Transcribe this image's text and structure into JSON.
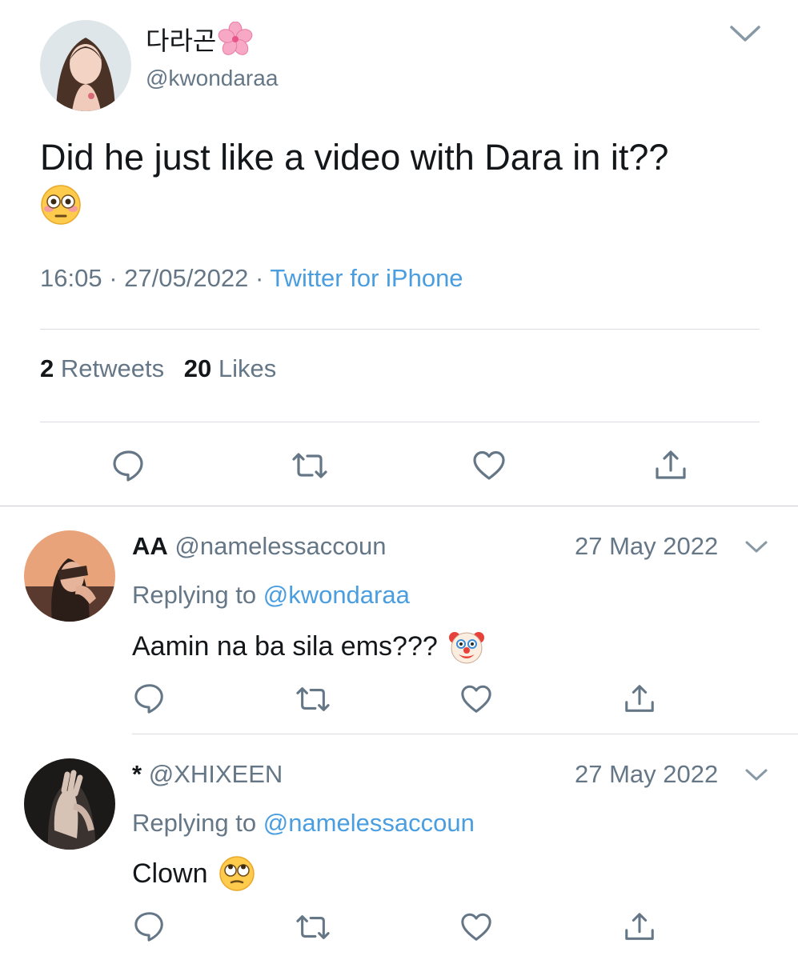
{
  "main_tweet": {
    "display_name": "다라곤",
    "name_emoji": "cherry-blossom-icon",
    "handle": "@kwondaraa",
    "text": "Did he just like a video with Dara in it??",
    "text_emoji": "flushed-face-icon",
    "time": "16:05",
    "date": "27/05/2022",
    "separator": "·",
    "source": "Twitter for iPhone",
    "retweets_count": "2",
    "retweets_label": "Retweets",
    "likes_count": "20",
    "likes_label": "Likes"
  },
  "replies": [
    {
      "name": "AA",
      "handle": "@namelessaccoun",
      "date": "27 May 2022",
      "replying_prefix": "Replying to",
      "replying_to": "@kwondaraa",
      "text": "Aamin na ba sila ems???",
      "emoji": "clown-face-icon"
    },
    {
      "name": "*",
      "handle": "@XHIXEEN",
      "date": "27 May 2022",
      "replying_prefix": "Replying to",
      "replying_to": "@namelessaccoun",
      "text": "Clown",
      "emoji": "eye-roll-face-icon"
    }
  ],
  "colors": {
    "text": "#14171a",
    "secondary": "#657786",
    "link": "#4a9ee0",
    "divider": "#d9dde1",
    "icon": "#657786"
  }
}
